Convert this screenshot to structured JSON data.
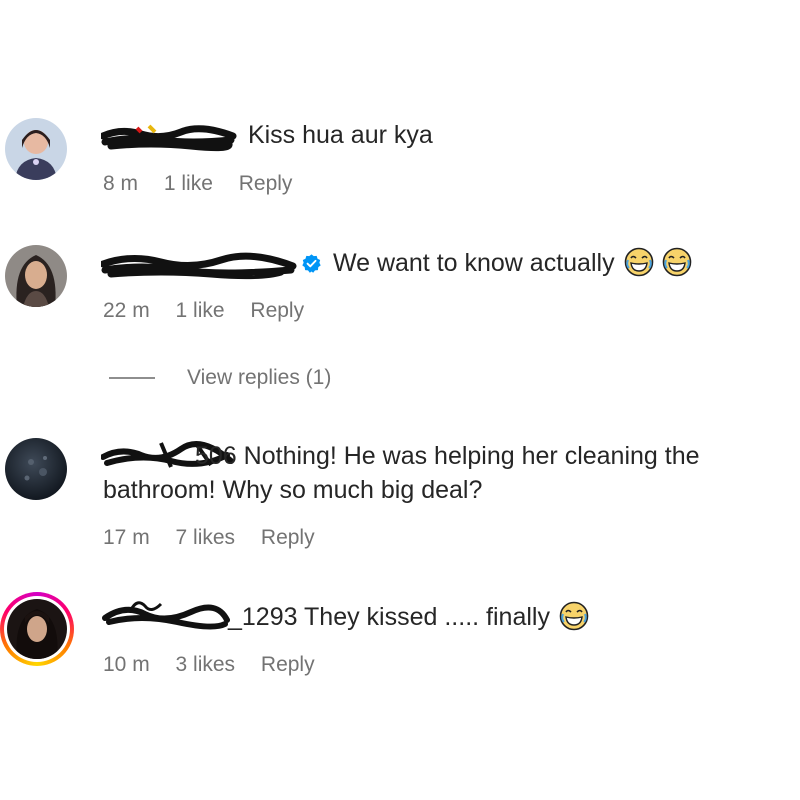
{
  "comments": [
    {
      "username": "dxxxxxlun",
      "text": "Kiss hua aur kya",
      "time": "8 m",
      "likes": "1 like",
      "reply": "Reply"
    },
    {
      "username": "frxxxxxxlgarg",
      "verified": true,
      "text": "We want to know actually",
      "time": "22 m",
      "likes": "1 like",
      "reply": "Reply",
      "view_replies": "View replies (1)"
    },
    {
      "username": "sixxxxxxgl1506",
      "username_visible_suffix": "506",
      "text": "Nothing! He was helping her cleaning the bathroom! Why so much big deal?",
      "time": "17 m",
      "likes": "7 likes",
      "reply": "Reply"
    },
    {
      "username": "qxxxxxxxe_1293",
      "username_visible_suffix": "_1293",
      "text": "They kissed ..... finally",
      "time": "10 m",
      "likes": "3 likes",
      "reply": "Reply"
    }
  ],
  "icons": {
    "verified": "verified-badge-icon",
    "emoji": "face-with-tears-of-joy"
  },
  "colors": {
    "text": "#262626",
    "meta": "#737373",
    "verified": "#0095f6",
    "story_ring": "#ff0069"
  }
}
